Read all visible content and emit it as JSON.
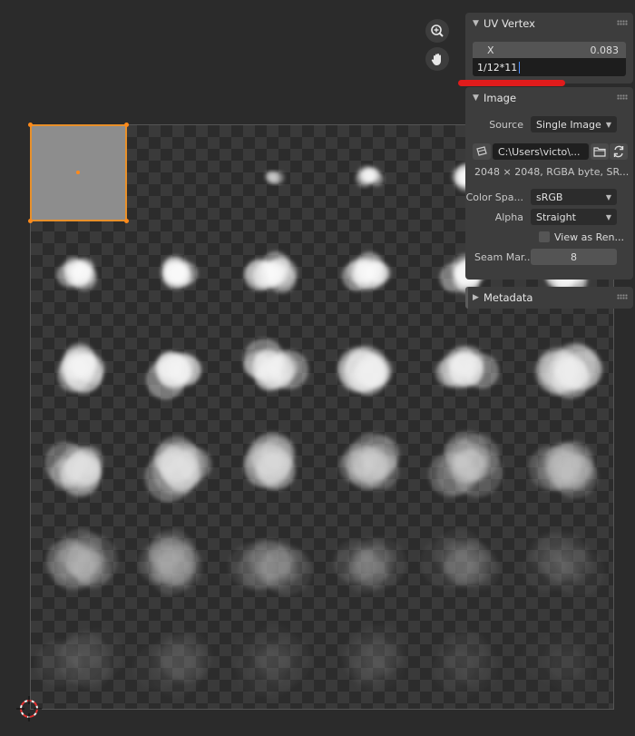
{
  "uv_vertex_panel": {
    "title": "UV Vertex",
    "x_label": "X",
    "x_value": "0.083",
    "edit_text": "1/12*11"
  },
  "image_panel": {
    "title": "Image",
    "source_label": "Source",
    "source_value": "Single Image",
    "filepath": "C:\\Users\\victo\\...",
    "info": "2048 × 2048,  RGBA byte,  SR...",
    "color_space_label": "Color Spa...",
    "color_space_value": "sRGB",
    "alpha_label": "Alpha",
    "alpha_value": "Straight",
    "view_as_render_label": "View as Ren...",
    "view_as_render_checked": false,
    "seam_margin_label": "Seam Mar...",
    "seam_margin_value": "8"
  },
  "metadata_panel": {
    "title": "Metadata"
  },
  "icons": {
    "zoom": "zoom-icon",
    "pan": "hand-icon",
    "cursor": "3d-cursor-icon",
    "file": "image-file-icon",
    "browse": "folder-icon",
    "reload": "reload-icon"
  },
  "colors": {
    "uv_selection": "#e8902a",
    "annotation": "#e01b1b",
    "panel_bg": "#3d3d3d",
    "field_bg": "#2c2c2c",
    "text_cursor": "#4a8dff"
  }
}
